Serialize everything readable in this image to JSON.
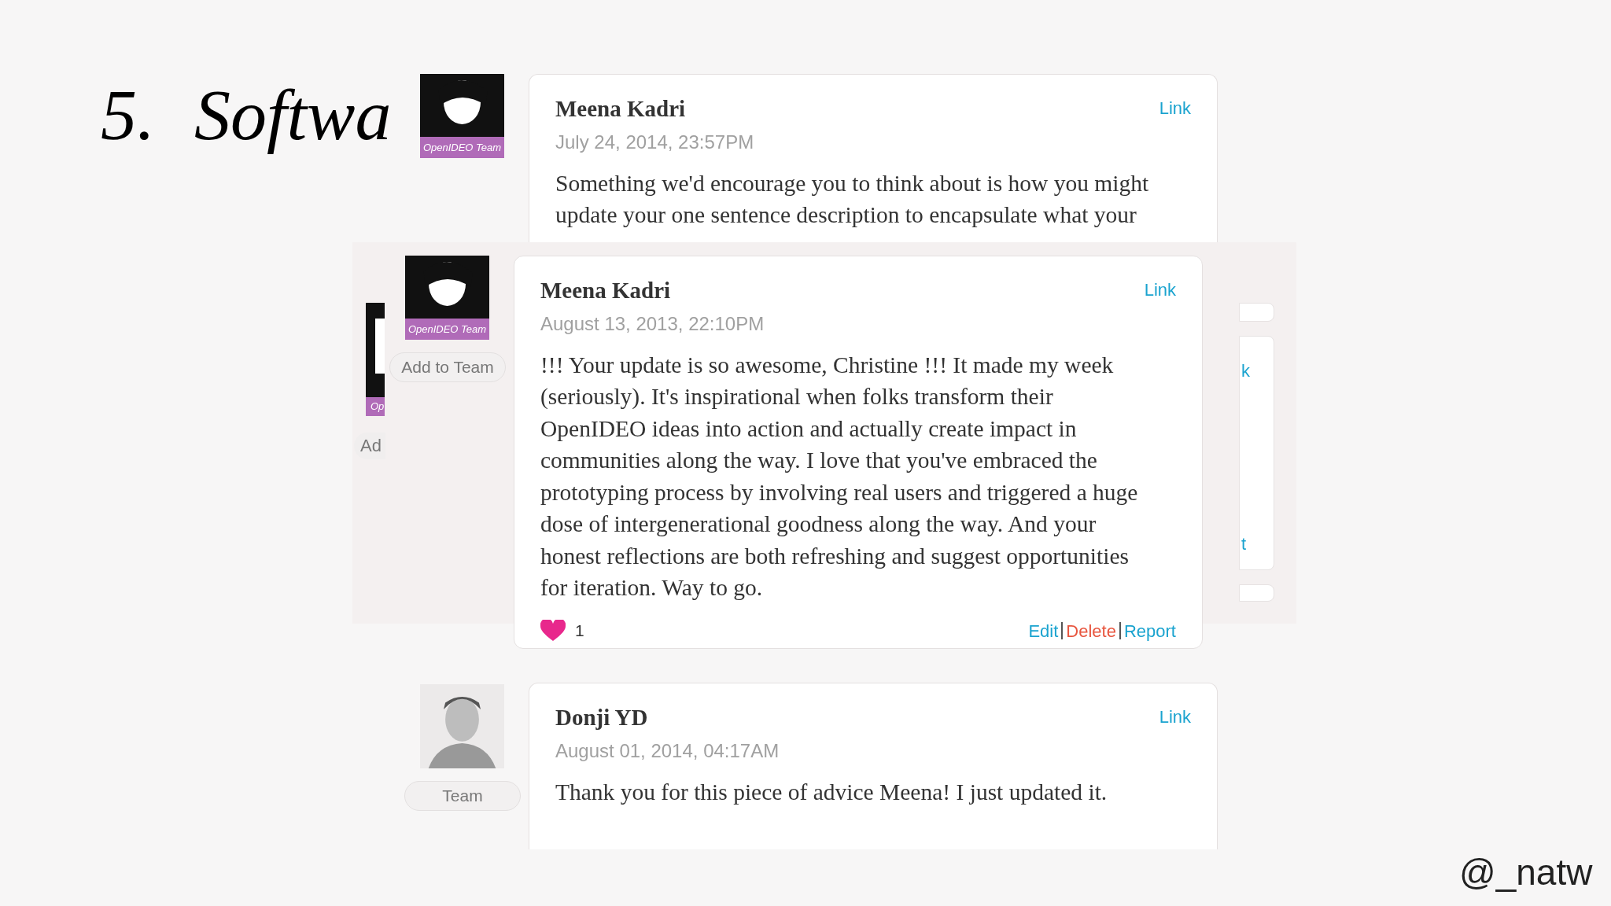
{
  "slide": {
    "number": "5.",
    "title": "Softwa",
    "handle": "@_natw"
  },
  "left_fragment": {
    "badge": "Op",
    "button": "Ad"
  },
  "right_fragment": {
    "texts": [
      "k",
      "t"
    ]
  },
  "comments": [
    {
      "author": "Meena Kadri",
      "date": "July 24, 2014, 23:57PM",
      "link": "Link",
      "badge": "OpenIDEO Team",
      "body": "Something we'd encourage you to think about is how you might update your one sentence description to encapsulate what your"
    },
    {
      "author": "Meena Kadri",
      "date": "August 13, 2013, 22:10PM",
      "link": "Link",
      "badge": "OpenIDEO Team",
      "team_button": "Add to Team",
      "body": "!!! Your update is so awesome, Christine !!! It made my week (seriously). It's inspirational when folks transform their OpenIDEO ideas into action and actually create impact in communities along the way. I love that you've embraced the prototyping process by involving real users and triggered a huge dose of intergenerational goodness along the way. And your honest reflections are both refreshing and suggest opportunities for iteration. Way to go.",
      "likes": "1",
      "actions": [
        {
          "label": "Edit",
          "kind": "normal"
        },
        {
          "label": "Delete",
          "kind": "danger"
        },
        {
          "label": "Report",
          "kind": "normal"
        }
      ]
    },
    {
      "author": "Donji YD",
      "date": "August 01, 2014, 04:17AM",
      "link": "Link",
      "team_button": "Team",
      "body": "Thank you for this piece of advice Meena! I just updated it."
    }
  ]
}
